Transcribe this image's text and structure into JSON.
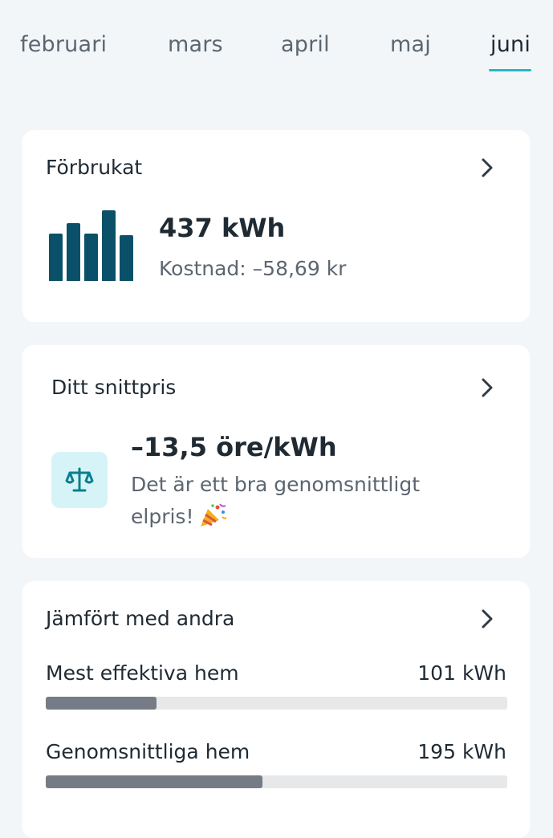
{
  "month_tabs": [
    {
      "label": "februari",
      "active": false
    },
    {
      "label": "mars",
      "active": false
    },
    {
      "label": "april",
      "active": false
    },
    {
      "label": "maj",
      "active": false
    },
    {
      "label": "juni",
      "active": true
    }
  ],
  "consumption_card": {
    "title": "Förbrukat",
    "value": "437 kWh",
    "cost": "Kostnad: –58,69 kr",
    "chart_icon": "bar-chart-icon",
    "bar_levels": [
      0.66,
      0.8,
      0.66,
      0.98,
      0.63
    ],
    "bar_color": "#0b5069"
  },
  "avg_price_card": {
    "title": "Ditt snittpris",
    "value": "–13,5 öre/kWh",
    "note": "Det är ett bra genomsnittligt elpris!",
    "icon": "scale-icon",
    "icon_bg": "#d6f4f7",
    "icon_color": "#0a7f8f",
    "emoji_icon": "party-popper-icon"
  },
  "compare_card": {
    "title": "Jämfört med andra",
    "rows": [
      {
        "label": "Mest effektiva hem",
        "value": "101 kWh",
        "fraction": 0.24
      },
      {
        "label": "Genomsnittliga hem",
        "value": "195 kWh",
        "fraction": 0.47
      }
    ],
    "fill_color": "#767c86",
    "track_color": "#e6e8ea"
  },
  "colors": {
    "background": "#f3f6f9",
    "accent": "#27b6c6",
    "text_primary": "#1f2a33",
    "text_secondary": "#5c6670"
  }
}
